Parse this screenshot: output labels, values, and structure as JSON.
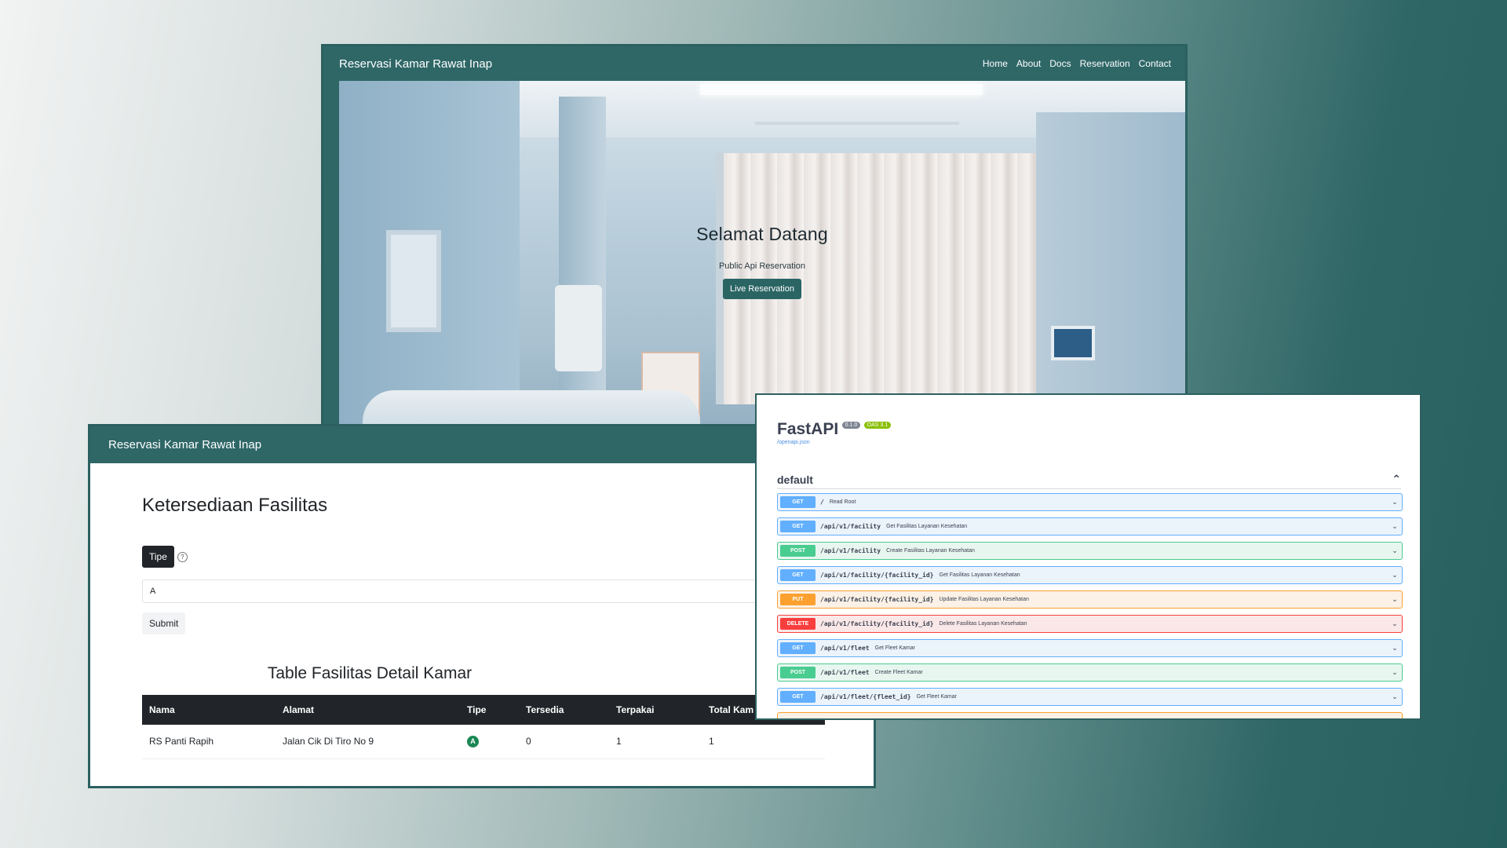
{
  "landing": {
    "brand": "Reservasi Kamar Rawat Inap",
    "menu": [
      "Home",
      "About",
      "Docs",
      "Reservation",
      "Contact"
    ],
    "hero_title": "Selamat Datang",
    "hero_subtitle": "Public Api Reservation",
    "hero_button": "Live Reservation"
  },
  "facility": {
    "brand": "Reservasi Kamar Rawat Inap",
    "title": "Ketersediaan Fasilitas",
    "tipe_label": "Tipe",
    "input_value": "A",
    "submit_label": "Submit",
    "table_title": "Table Fasilitas Detail Kamar",
    "columns": [
      "Nama",
      "Alamat",
      "Tipe",
      "Tersedia",
      "Terpakai",
      "Total Kam"
    ],
    "rows": [
      {
        "nama": "RS Panti Rapih",
        "alamat": "Jalan Cik Di Tiro No 9",
        "tipe": "A",
        "tersedia": "0",
        "terpakai": "1",
        "total": "1"
      }
    ]
  },
  "api": {
    "title": "FastAPI",
    "version": "0.1.0",
    "oas": "OAS 3.1",
    "openapi_link": "/openapi.json",
    "section": "default",
    "operations": [
      {
        "method": "GET",
        "path": "/",
        "desc": "Read Root"
      },
      {
        "method": "GET",
        "path": "/api/v1/facility",
        "desc": "Get Fasilitas Layanan Kesehatan"
      },
      {
        "method": "POST",
        "path": "/api/v1/facility",
        "desc": "Create Fasilitas Layanan Kesehatan"
      },
      {
        "method": "GET",
        "path": "/api/v1/facility/{facility_id}",
        "desc": "Get Fasilitas Layanan Kesehatan"
      },
      {
        "method": "PUT",
        "path": "/api/v1/facility/{facility_id}",
        "desc": "Update Fasilitas Layanan Kesehatan"
      },
      {
        "method": "DELETE",
        "path": "/api/v1/facility/{facility_id}",
        "desc": "Delete Fasilitas Layanan Kesehatan"
      },
      {
        "method": "GET",
        "path": "/api/v1/fleet",
        "desc": "Get Fleet Kamar"
      },
      {
        "method": "POST",
        "path": "/api/v1/fleet",
        "desc": "Create Fleet Kamar"
      },
      {
        "method": "GET",
        "path": "/api/v1/fleet/{fleet_id}",
        "desc": "Get Fleet Kamar"
      }
    ]
  },
  "colors": {
    "brand_teal": "#2f6767",
    "get": "#61affe",
    "post": "#49cc90",
    "put": "#fca130",
    "delete": "#f93e3e",
    "badge_green": "#198754"
  }
}
